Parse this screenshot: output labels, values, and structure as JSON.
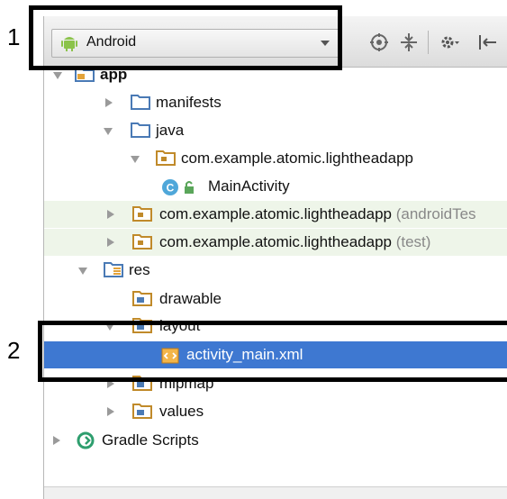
{
  "callouts": [
    "1",
    "2"
  ],
  "toolbar": {
    "view_mode": "Android",
    "icons": [
      "target-icon",
      "collapse-all-icon",
      "settings-gear-icon",
      "hide-panel-icon"
    ]
  },
  "tree": {
    "app": "app",
    "manifests": "manifests",
    "java": "java",
    "package_main": "com.example.atomic.lightheadapp",
    "main_activity": "MainActivity",
    "package_android_test": "com.example.atomic.lightheadapp",
    "package_android_test_suffix": "(androidTes",
    "package_test": "com.example.atomic.lightheadapp",
    "package_test_suffix": "(test)",
    "res": "res",
    "drawable": "drawable",
    "layout": "layout",
    "activity_main": "activity_main.xml",
    "mipmap": "mipmap",
    "values": "values",
    "gradle_scripts": "Gradle Scripts"
  },
  "colors": {
    "selection": "#3e78d1",
    "folder_blue": "#4a7ab5",
    "package_tint": "#eef5e9"
  }
}
